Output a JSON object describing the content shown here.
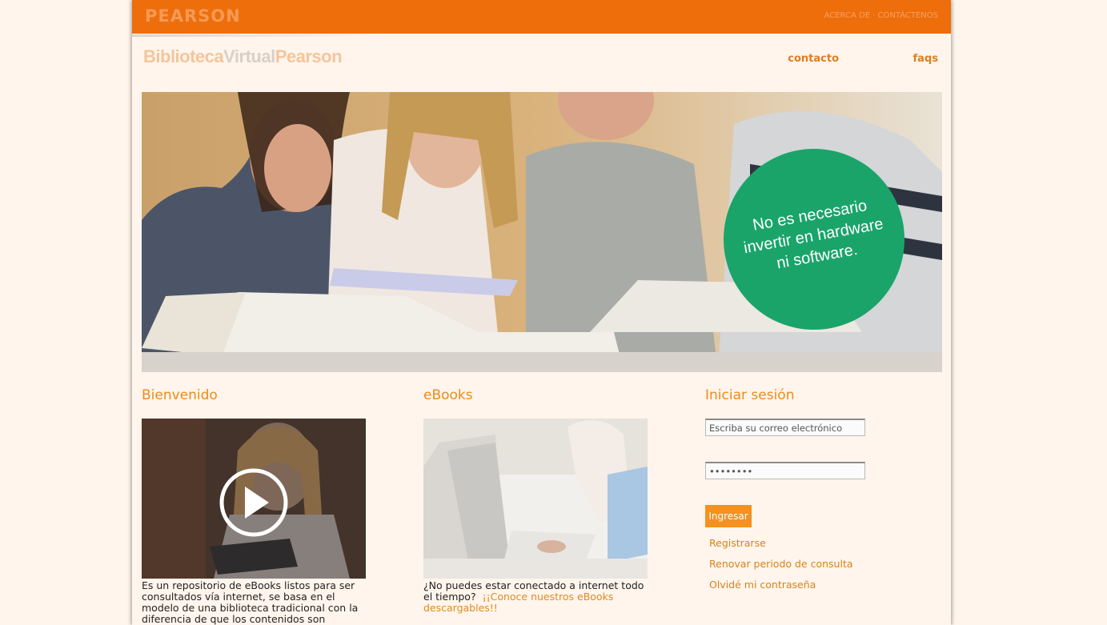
{
  "header": {
    "brand": "PEARSON",
    "top_links": "ACERCA DE · CONTÁCTENOS",
    "logo": {
      "part1": "Biblioteca",
      "part2": "Virtual",
      "part3": "Pearson"
    },
    "nav": [
      {
        "label": "contacto"
      },
      {
        "label": "faqs"
      }
    ]
  },
  "hero": {
    "badge_lines": [
      "No es necesario",
      "invertir en hardware",
      "ni software."
    ],
    "badge_color": "#1aa46a"
  },
  "columns": {
    "welcome": {
      "title": "Bienvenido",
      "description": "Es un repositorio de eBooks listos para ser consultados vía internet, se basa en el modelo de una biblioteca tradicional con la diferencia de que los contenidos son"
    },
    "ebooks": {
      "title": "eBooks",
      "description": "¿No puedes estar conectado a internet todo el tiempo?",
      "link": "¡¡Conoce nuestros eBooks descargables!!"
    },
    "login": {
      "title": "Iniciar sesión",
      "email_placeholder": "Escriba su correo electrónico",
      "password_value": "••••••••",
      "submit_label": "Ingresar",
      "links": [
        "Registrarse",
        "Renovar periodo de consulta",
        "Olvidé mi contraseña"
      ]
    }
  },
  "colors": {
    "accent": "#ee6e0c",
    "link": "#e07d1f",
    "background": "#fff5ec"
  }
}
